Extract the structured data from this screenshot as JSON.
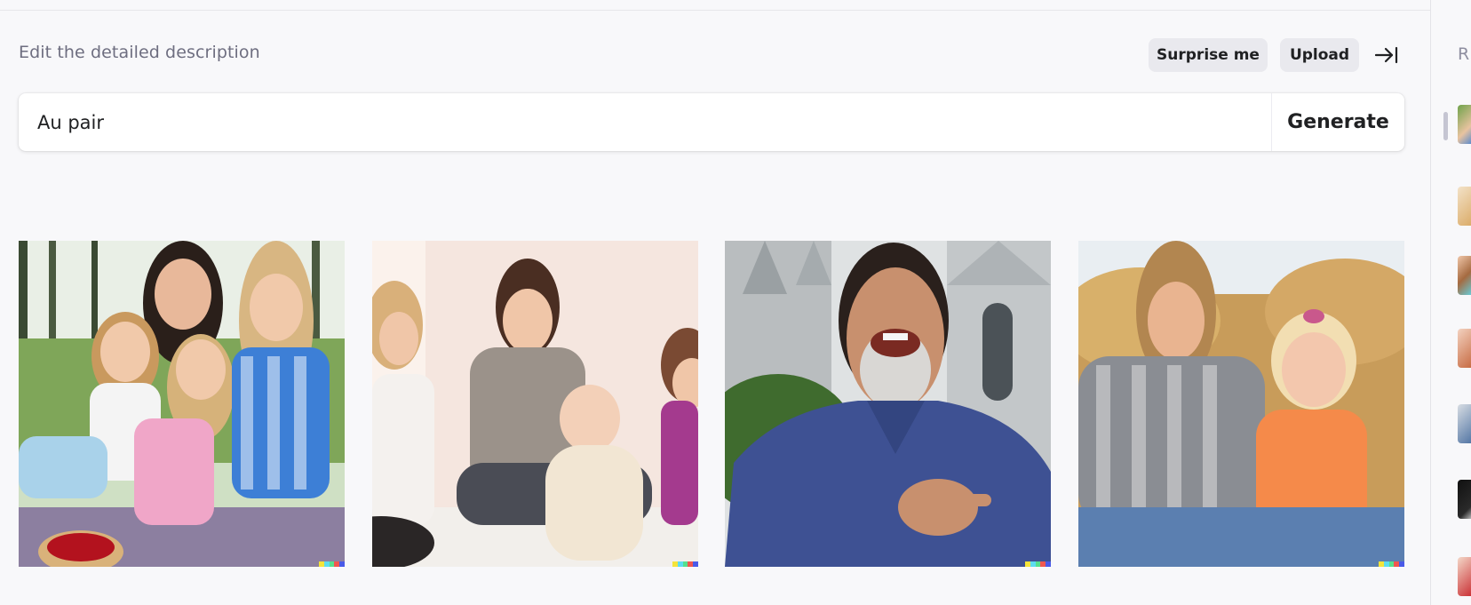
{
  "header": {
    "heading": "Edit the detailed description",
    "surprise_label": "Surprise me",
    "upload_label": "Upload",
    "collapse_icon": "arrow-right-to-bar-icon"
  },
  "prompt": {
    "value": "Au pair",
    "generate_label": "Generate"
  },
  "results": [
    {
      "name": "result-image-1",
      "alt": "Woman with three girls sitting on grass"
    },
    {
      "name": "result-image-2",
      "alt": "Women around a baby wrapped in a blanket"
    },
    {
      "name": "result-image-3",
      "alt": "Laughing man in blue polo shirt in front of church"
    },
    {
      "name": "result-image-4",
      "alt": "Woman and toddler sitting in front of hay bales"
    }
  ],
  "sidebar": {
    "label": "R",
    "thumbnail_count": 7
  },
  "colors": {
    "background": "#f8f8fa",
    "pill": "#e9e9ee",
    "signature": [
      "#f5e43a",
      "#5ddcf0",
      "#56e08d",
      "#f0574f",
      "#4a5ae8"
    ]
  }
}
